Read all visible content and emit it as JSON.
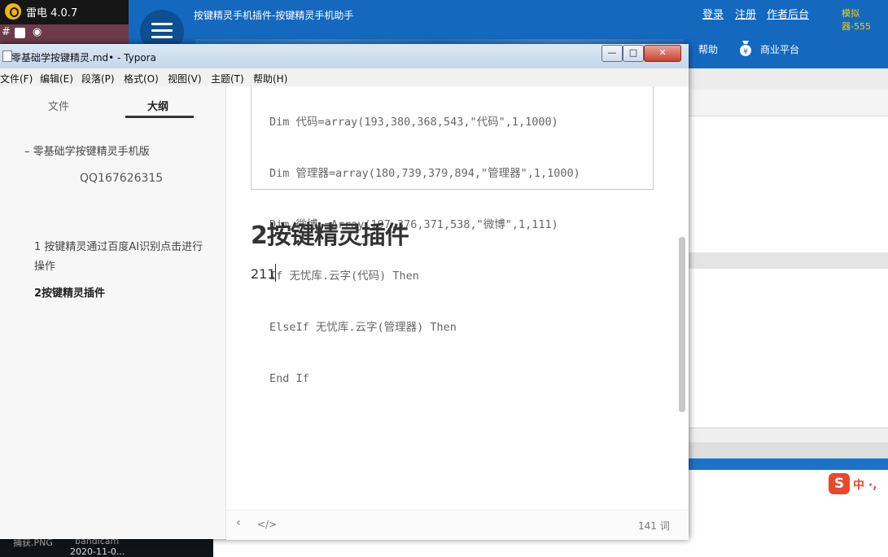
{
  "background": {
    "ldplayer": {
      "title": "雷电 4.0.7",
      "tool_icons": [
        "#",
        "square-icon",
        "weibo-icon"
      ],
      "taskbar_file_1": "捕获.PNG",
      "taskbar_file_2": "bandicam",
      "taskbar_date": "2020-11-0..."
    },
    "helper": {
      "title": "按键精灵手机插件-按键精灵手机助手",
      "login": "登录",
      "register": "注册",
      "author_console": "作者后台",
      "emulator": "模拟器-555",
      "help": "帮助",
      "business": "商业平台",
      "ime_logo": "S",
      "ime_text": "中 ·,"
    }
  },
  "window": {
    "title": "零基础学按键精灵.md• - Typora",
    "buttons": {
      "minimize": "—",
      "maximize": "□",
      "close": "✕"
    },
    "menu": [
      "文件(F)",
      "编辑(E)",
      "段落(P)",
      "格式(O)",
      "视图(V)",
      "主题(T)",
      "帮助(H)"
    ]
  },
  "sidebar": {
    "tabs": {
      "files": "文件",
      "outline": "大纲"
    },
    "outline": {
      "root": "零基础学按键精灵手机版",
      "qq": "QQ167626315",
      "item1": "1 按键精灵通过百度AI识别点击进行操作",
      "item2": "2按键精灵插件"
    }
  },
  "editor": {
    "code_lines": [
      "Dim 代码=array(193,380,368,543,\"代码\",1,1000)",
      "Dim 管理器=array(180,739,379,894,\"管理器\",1,1000)",
      "Dim 微博 =Array(197,376,371,538,\"微博\",1,111)",
      "If 无忧库.云字(代码) Then",
      "ElseIf 无忧库.云字(管理器) Then",
      "End If"
    ],
    "heading": "2按键精灵插件",
    "paragraph": "211"
  },
  "status": {
    "back": "‹",
    "source": "</>",
    "word_count": "141 词"
  }
}
